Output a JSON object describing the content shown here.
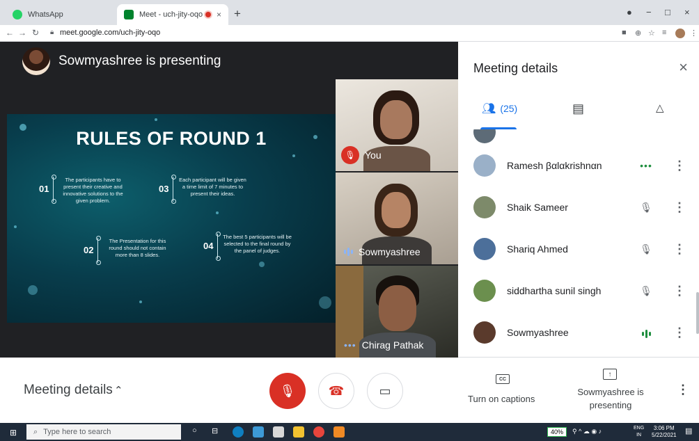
{
  "browser": {
    "tabs": [
      {
        "title": "WhatsApp",
        "favicon_color": "#25d366"
      },
      {
        "title": "Meet - uch-jity-oqo",
        "favicon_color": "#00832d"
      }
    ],
    "new_tab": "+",
    "url": "meet.google.com/uch-jity-oqo",
    "window_controls": {
      "minimize": "−",
      "maximize": "□",
      "close": "×"
    }
  },
  "presenter": {
    "text": "Sowmyashree is presenting"
  },
  "slide": {
    "title": "RULES OF ROUND 1",
    "rules": [
      {
        "num": "01",
        "text": "The participants have to present their creative and innovative solutions to the given problem."
      },
      {
        "num": "03",
        "text": "Each participant will be given a time limit of 7 minutes to present their ideas."
      },
      {
        "num": "02",
        "text": "The Presentation for this round should not contain more than 8 slides."
      },
      {
        "num": "04",
        "text": "The best 5 participants will be selected to the final round by the panel of judges."
      }
    ]
  },
  "tiles": [
    {
      "name": "You",
      "status": "muted"
    },
    {
      "name": "Sowmyashree",
      "status": "speaking"
    },
    {
      "name": "Chirag Pathak",
      "status": "dots"
    }
  ],
  "panel": {
    "title": "Meeting details",
    "close": "×",
    "people_count": "(25)",
    "people": [
      {
        "name": "Ramesh βαlαkrishnαn",
        "status": "dots",
        "avatar_color": "#9ab0c8"
      },
      {
        "name": "Shaik Sameer",
        "status": "muted",
        "avatar_color": "#7d8a6a"
      },
      {
        "name": "Shariq Ahmed",
        "status": "muted",
        "avatar_color": "#4c6f9a"
      },
      {
        "name": "siddhartha sunil singh",
        "status": "muted",
        "avatar_color": "#6b8f4e"
      },
      {
        "name": "Sowmyashree",
        "status": "speaking",
        "avatar_color": "#5a3a2c"
      }
    ]
  },
  "bottom": {
    "meeting_details": "Meeting details",
    "captions_label": "Turn on captions",
    "cc_icon": "CC",
    "presenting_label": "Sowmyashree is presenting"
  },
  "taskbar": {
    "search_placeholder": "Type here to search",
    "battery": "40%",
    "lang1": "ENG",
    "lang2": "IN",
    "time": "3:06 PM",
    "date": "5/22/2021"
  },
  "colors": {
    "accent": "#1a73e8",
    "danger": "#d93025",
    "speaking": "#1e8e3e"
  }
}
